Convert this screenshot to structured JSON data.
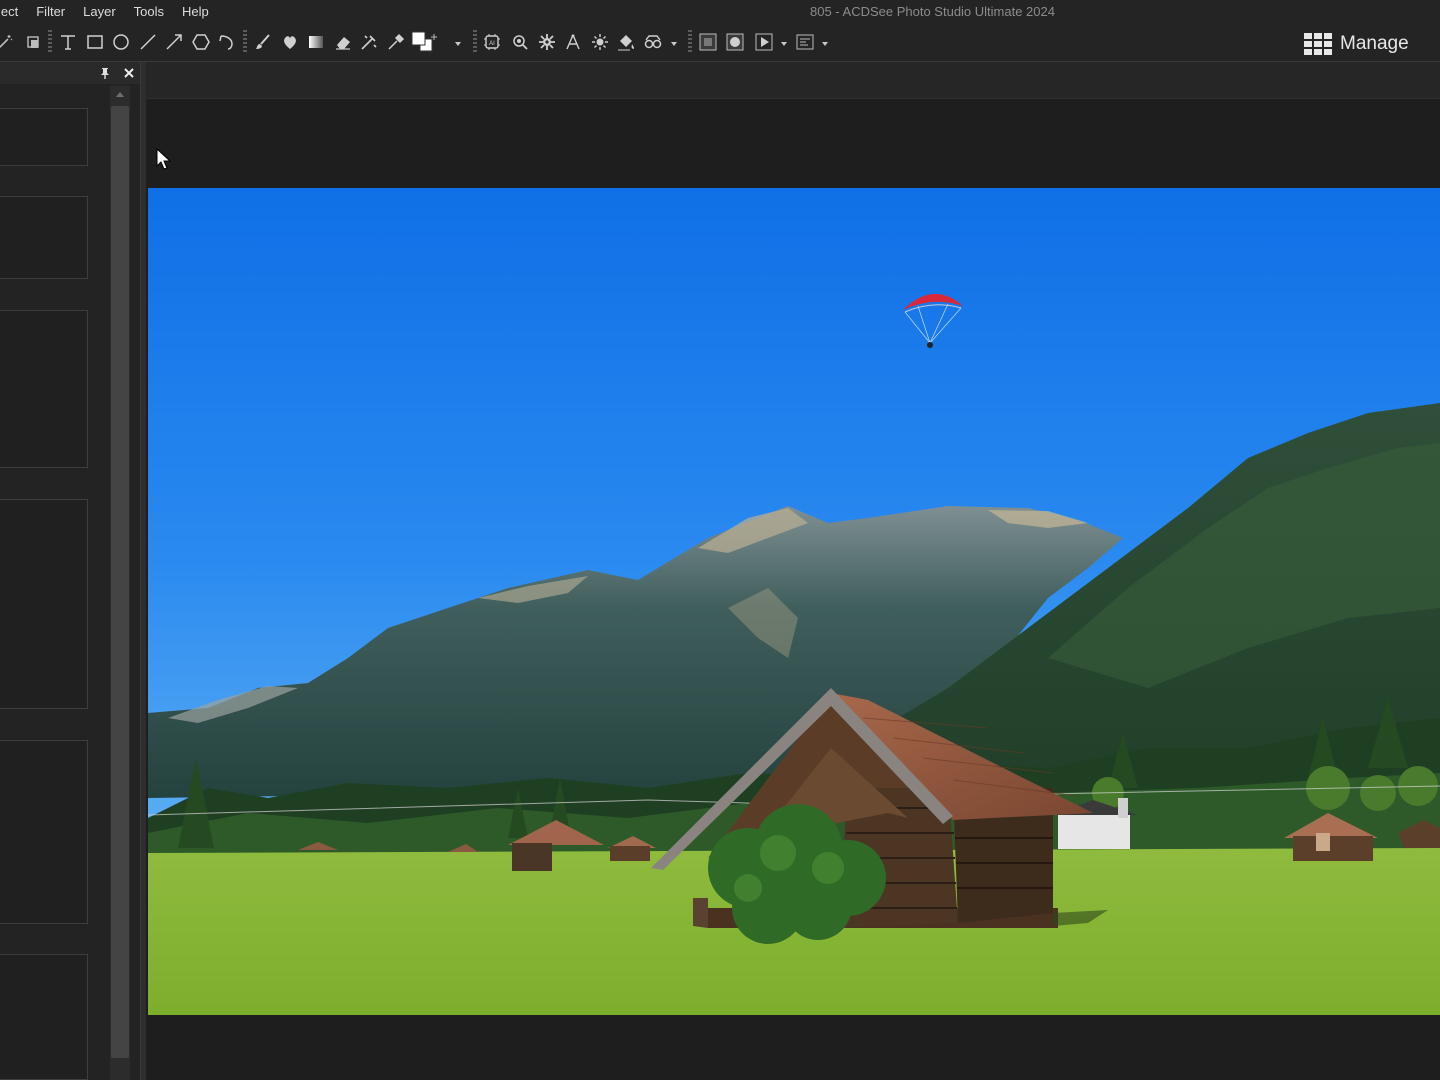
{
  "menu": {
    "items": [
      {
        "label": "lect"
      },
      {
        "label": "Filter"
      },
      {
        "label": "Layer"
      },
      {
        "label": "Tools"
      },
      {
        "label": "Help"
      }
    ]
  },
  "window": {
    "title": "805 - ACDSee Photo Studio Ultimate 2024"
  },
  "toolbar": {
    "tools": [
      "magic-wand-icon",
      "stamp-icon",
      "text-icon",
      "rectangle-icon",
      "ellipse-icon",
      "line-icon",
      "arrow-icon",
      "polygon-icon",
      "lasso-icon",
      "brush-icon",
      "heal-icon",
      "gradient-icon",
      "eraser-icon",
      "clone-icon",
      "eyedropper-icon",
      "color-swatch-icon",
      "ai-select-icon",
      "settings-select-icon",
      "gear-icon",
      "perspective-icon",
      "light-icon",
      "bucket-icon",
      "red-eye-icon",
      "mask-square-icon",
      "mask-circle-icon",
      "play-icon",
      "export-icon"
    ],
    "foreground_color": "#ffffff",
    "background_color": "#ffffff"
  },
  "mode": {
    "manage_label": "Manage"
  },
  "colors": {
    "chrome": "#242424",
    "panel": "#232323",
    "workspace": "#1e1e1e",
    "text": "#dcdcdc"
  }
}
